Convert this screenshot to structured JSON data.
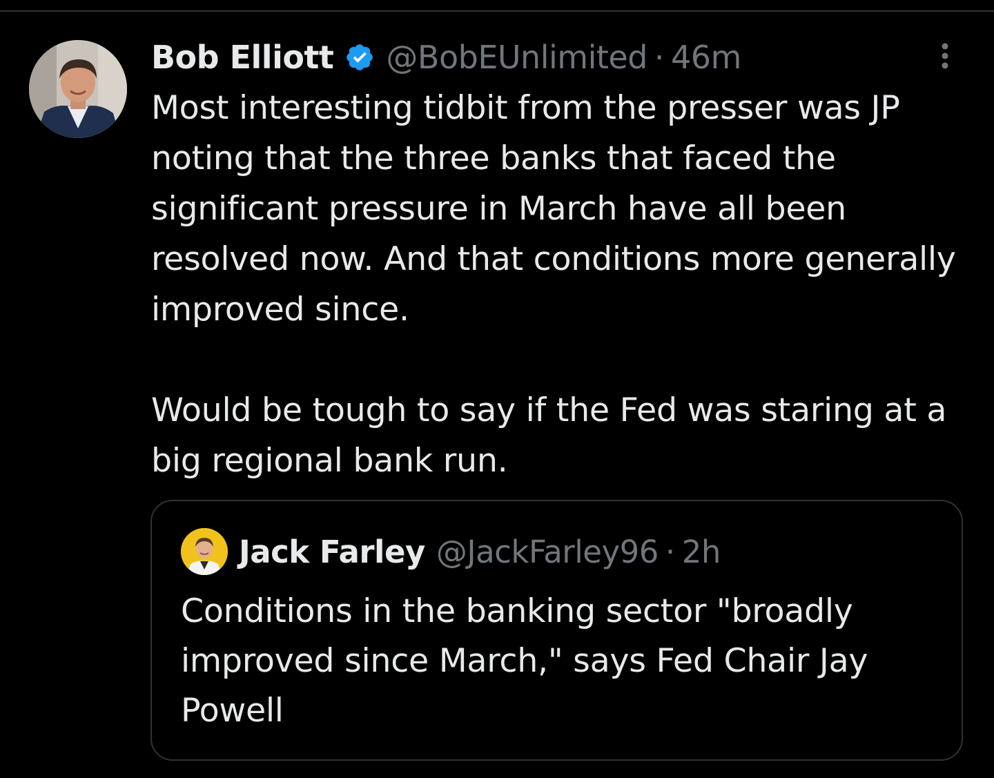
{
  "tweet": {
    "author": {
      "display_name": "Bob Elliott",
      "handle": "@BobEUnlimited",
      "verified": true,
      "avatar_icon": "profile-photo-man-in-suit"
    },
    "timestamp": "46m",
    "separator": "·",
    "paragraphs": [
      "Most interesting tidbit from the presser was JP noting that the three banks that faced the significant pressure in March have all been resolved now.  And that conditions more generally improved since.",
      "Would be tough to say if the Fed was staring at a big regional bank run."
    ],
    "more_icon": "more-vertical-icon"
  },
  "quoted_tweet": {
    "author": {
      "display_name": "Jack Farley",
      "handle": "@JackFarley96",
      "avatar_icon": "profile-photo-man-yellow-background"
    },
    "timestamp": "2h",
    "separator": "·",
    "text": "Conditions in the banking sector \"broadly improved since March,\" says Fed Chair Jay Powell"
  },
  "colors": {
    "background": "#000000",
    "text_primary": "#e7e9ea",
    "text_secondary": "#71767b",
    "border": "#2f3336",
    "verified_blue": "#1d9bf0"
  }
}
